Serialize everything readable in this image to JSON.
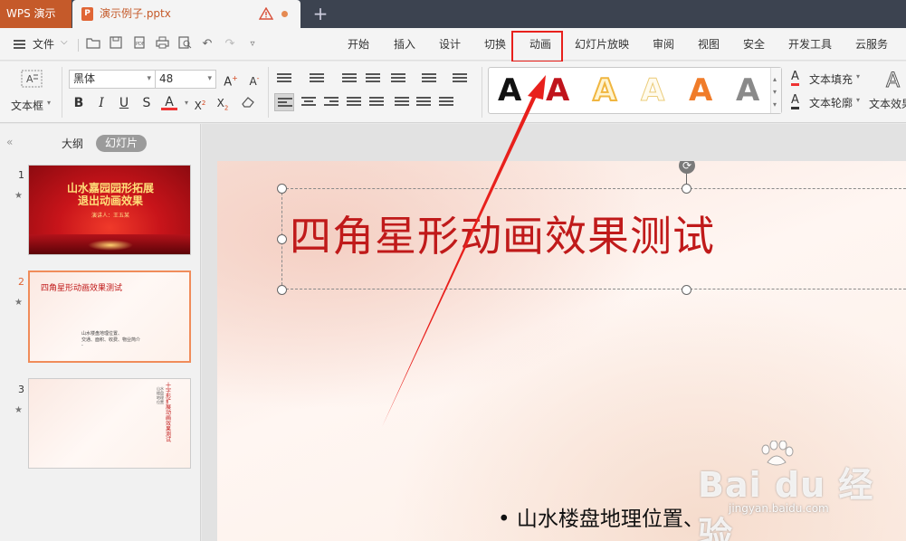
{
  "app": {
    "name": "WPS 演示",
    "document_name": "演示例子.pptx"
  },
  "menu": {
    "file": "文件",
    "tabs": [
      "开始",
      "插入",
      "设计",
      "切换",
      "动画",
      "幻灯片放映",
      "审阅",
      "视图",
      "安全",
      "开发工具",
      "云服务"
    ],
    "highlighted_tab": "动画"
  },
  "ribbon": {
    "textbox_label": "文本框",
    "font_name": "黑体",
    "font_size": "48",
    "text_fill": "文本填充",
    "text_outline": "文本轮廓",
    "text_effects": "文本效果",
    "wordart_sample": "A"
  },
  "left_panel": {
    "outline_tab": "大纲",
    "slides_tab": "幻灯片",
    "slides": [
      {
        "number": "1",
        "title": "山水嘉园园形拓展退出动画效果",
        "subtitle": "演讲人：王五某"
      },
      {
        "number": "2",
        "title": "四角星形动画效果测试",
        "bullets": [
          "山水楼盘地理位置、",
          "交通、面积、收费、物业简介",
          "-"
        ]
      },
      {
        "number": "3",
        "vertical_title": "十字形扩展动画效果测试",
        "vertical_sub": "山水楼盘地理位置"
      }
    ]
  },
  "slide": {
    "title": "四角星形动画效果测试",
    "bullet": "山水楼盘地理位置、"
  },
  "watermark": {
    "text": "Bai du 经验",
    "url": "jingyan.baidu.com"
  },
  "colors": {
    "accent_orange": "#c55a2a",
    "title_red": "#c01a1a",
    "annotation_red": "#e8201c"
  }
}
